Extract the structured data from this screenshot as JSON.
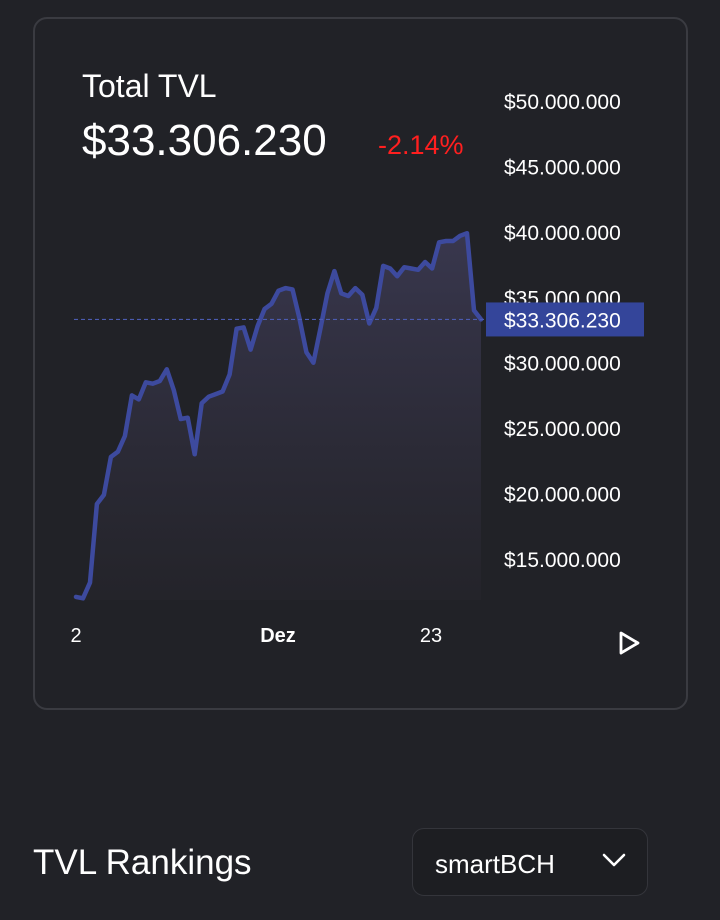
{
  "header": {
    "title": "Total TVL",
    "value": "$33.306.230",
    "change": "-2.14%"
  },
  "colors": {
    "background": "#212227",
    "line": "#3d4a9e",
    "negative": "#ff1f1f",
    "current_tag": "#34459a"
  },
  "chart_data": {
    "type": "area",
    "title": "Total TVL",
    "xlabel": "",
    "ylabel": "",
    "y_ticks": [
      {
        "value": 50000000,
        "label": "$50.000.000"
      },
      {
        "value": 45000000,
        "label": "$45.000.000"
      },
      {
        "value": 40000000,
        "label": "$40.000.000"
      },
      {
        "value": 35000000,
        "label": "$35.000.000"
      },
      {
        "value": 30000000,
        "label": "$30.000.000"
      },
      {
        "value": 25000000,
        "label": "$25.000.000"
      },
      {
        "value": 20000000,
        "label": "$20.000.000"
      },
      {
        "value": 15000000,
        "label": "$15.000.000"
      }
    ],
    "x_ticks": [
      "2",
      "Dez",
      "23"
    ],
    "x_ticks_bold": [
      false,
      true,
      false
    ],
    "current": {
      "value": 33306230,
      "label": "$33.306.230"
    },
    "ylim": [
      12000000,
      52000000
    ],
    "series": [
      {
        "values": [
          12100000,
          12000000,
          13200000,
          19200000,
          19900000,
          22800000,
          23200000,
          24400000,
          27500000,
          27200000,
          28500000,
          28400000,
          28600000,
          29500000,
          27900000,
          25700000,
          25800000,
          23000000,
          26900000,
          27400000,
          27600000,
          27800000,
          29100000,
          32600000,
          32700000,
          31000000,
          32800000,
          34100000,
          34500000,
          35500000,
          35700000,
          35600000,
          33400000,
          30800000,
          30000000,
          32600000,
          35300000,
          37000000,
          35300000,
          35100000,
          35700000,
          35200000,
          33000000,
          34200000,
          37400000,
          37200000,
          36600000,
          37300000,
          37200000,
          37100000,
          37700000,
          37200000,
          39200000,
          39300000,
          39300000,
          39700000,
          39900000,
          34000000,
          33306230
        ]
      }
    ]
  },
  "controls": {
    "play_icon": "play-icon"
  },
  "rankings": {
    "title": "TVL Rankings",
    "selected_chain": "smartBCH",
    "dropdown_icon": "chevron-down-icon"
  }
}
